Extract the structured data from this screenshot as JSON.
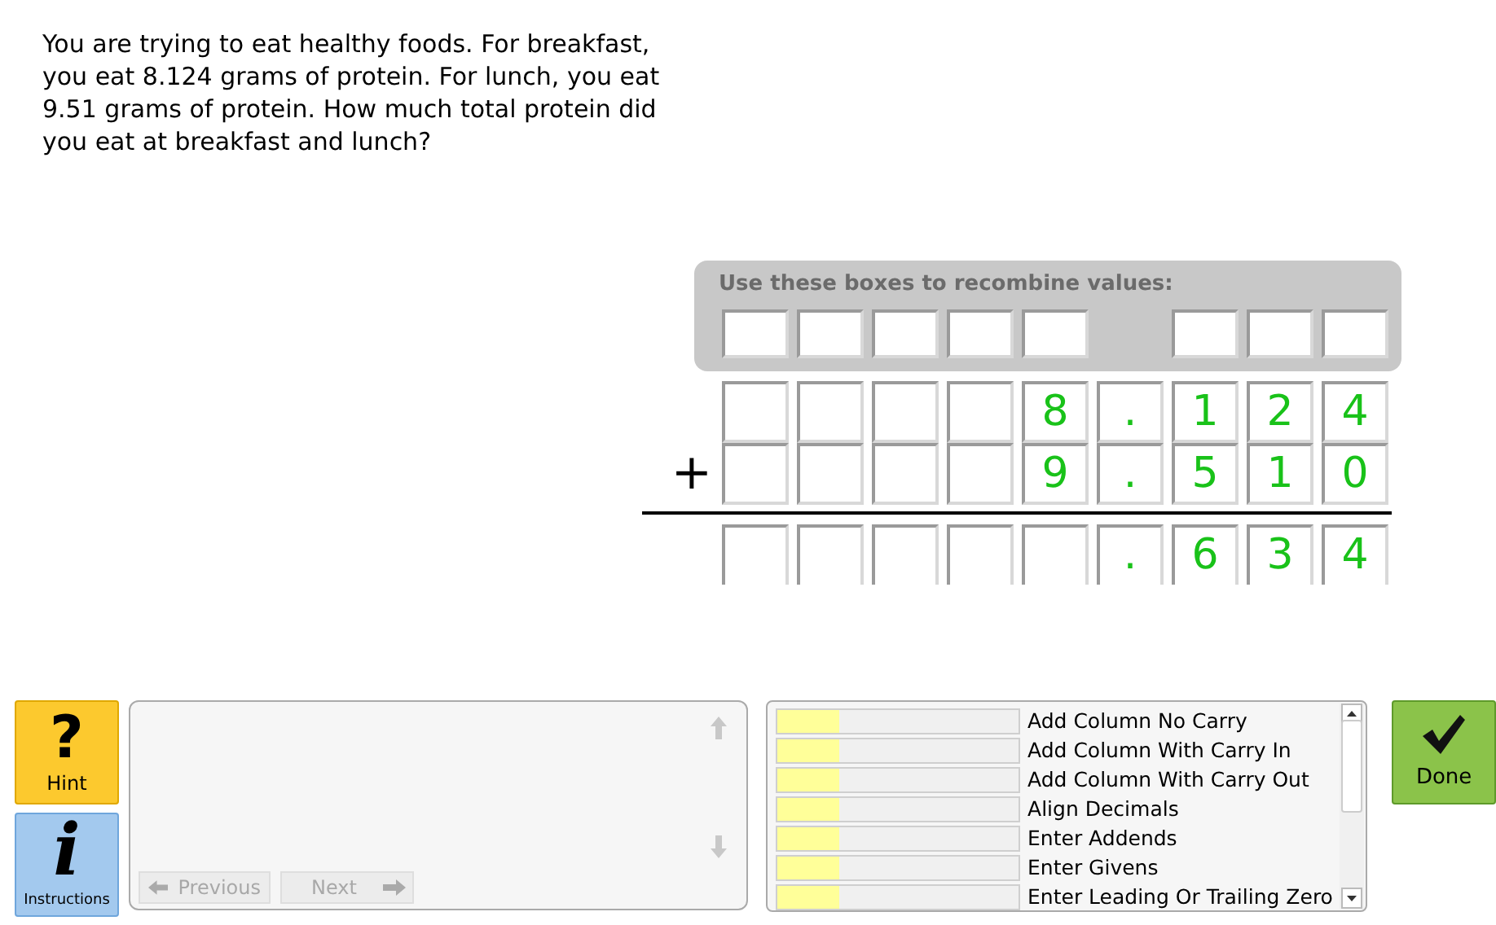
{
  "question": "You are trying to eat healthy foods. For breakfast, you eat 8.124 grams of protein. For lunch, you eat 9.51 grams of protein. How much total protein did you eat at breakfast and lunch?",
  "recombine": {
    "label": "Use these boxes to recombine values:",
    "boxes": [
      {
        "kind": "box"
      },
      {
        "kind": "box"
      },
      {
        "kind": "box"
      },
      {
        "kind": "box"
      },
      {
        "kind": "box"
      },
      {
        "kind": "gap"
      },
      {
        "kind": "box"
      },
      {
        "kind": "box"
      },
      {
        "kind": "box"
      }
    ]
  },
  "problem": {
    "operator": "+",
    "rows": [
      {
        "kind": "addend",
        "cells": [
          null,
          null,
          null,
          null,
          "8",
          ".",
          "1",
          "2",
          "4"
        ]
      },
      {
        "kind": "addend",
        "cells": [
          null,
          null,
          null,
          null,
          "9",
          ".",
          "5",
          "1",
          "0"
        ]
      },
      {
        "kind": "sum",
        "cells": [
          null,
          null,
          null,
          null,
          null,
          ".",
          "6",
          "3",
          "4"
        ]
      }
    ]
  },
  "hint_button": {
    "symbol": "?",
    "label": "Hint"
  },
  "instructions_button": {
    "symbol": "i",
    "label": "Instructions"
  },
  "hint_panel": {
    "previous": {
      "label": "Previous",
      "disabled": true
    },
    "next": {
      "label": "Next",
      "disabled": true
    }
  },
  "skills": [
    {
      "name": "Add Column No Carry",
      "level": 0.26
    },
    {
      "name": "Add Column With Carry In",
      "level": 0.26
    },
    {
      "name": "Add Column With Carry Out",
      "level": 0.26
    },
    {
      "name": "Align Decimals",
      "level": 0.26
    },
    {
      "name": "Enter Addends",
      "level": 0.26
    },
    {
      "name": "Enter Givens",
      "level": 0.26
    },
    {
      "name": "Enter Leading Or Trailing Zero",
      "level": 0.26
    }
  ],
  "done_button": {
    "label": "Done"
  }
}
